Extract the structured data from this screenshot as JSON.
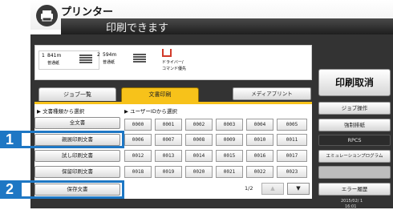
{
  "header": {
    "app_title": "プリンター",
    "status": "印刷できます"
  },
  "info": {
    "tray1_num": "1",
    "tray1_size": "841m",
    "tray1_sub": "普通紙",
    "tray2_num": "2",
    "tray2_size": "594m",
    "tray2_sub": "普通紙",
    "driver_label_1": "ドライバー/",
    "driver_label_2": "コマンド優先"
  },
  "tabs": [
    {
      "label": "ジョブ一覧"
    },
    {
      "label": "文書印刷"
    },
    {
      "label": "メディアプリント"
    }
  ],
  "select_by_type": "▶ 文書種類から選択",
  "select_by_user": "▶ ユーザーIDから選択",
  "doc_types": [
    {
      "label": "全文書"
    },
    {
      "label": "親展印刷文書"
    },
    {
      "label": "試し印刷文書"
    },
    {
      "label": "保留印刷文書"
    },
    {
      "label": "保存文書"
    }
  ],
  "user_ids": [
    [
      "0000",
      "0001",
      "0002",
      "0003",
      "0004",
      "0005"
    ],
    [
      "0006",
      "0007",
      "0008",
      "0009",
      "0010",
      "0011"
    ],
    [
      "0012",
      "0013",
      "0014",
      "0015",
      "0016",
      "0017"
    ],
    [
      "0018",
      "0019",
      "0020",
      "0021",
      "0022",
      "0023"
    ]
  ],
  "pager": {
    "page": "1/2",
    "up": "▲",
    "down": "▼"
  },
  "right_panel": {
    "cancel_print": "印刷取消",
    "job_operation": "ジョブ操作",
    "forced_discharge": "強制排紙",
    "section_label": "RPCS",
    "emulation": "エミュレーションプログラム",
    "blank_button": "",
    "error_log": "エラー履歴"
  },
  "datetime": {
    "date": "2015/02/ 1",
    "time": "16:01"
  },
  "callouts": [
    "1",
    "2"
  ]
}
